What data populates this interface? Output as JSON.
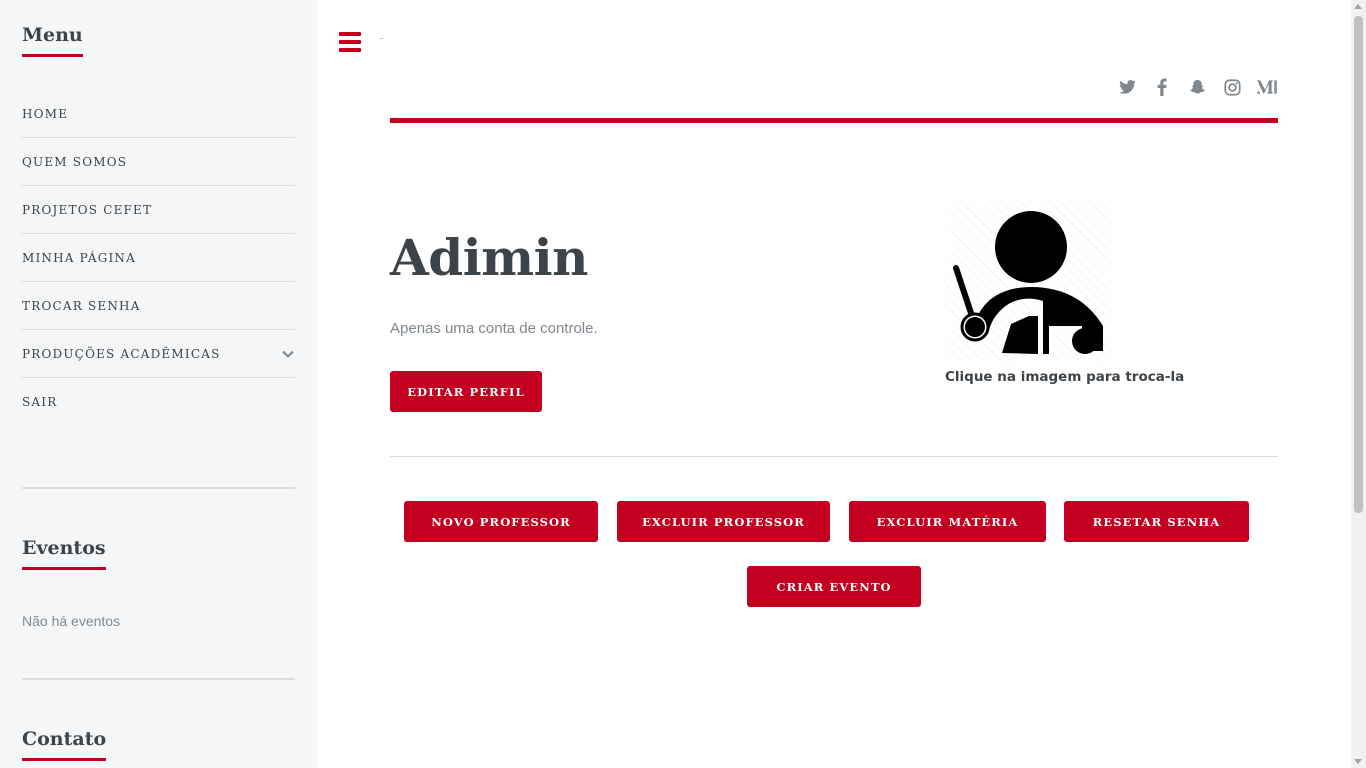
{
  "sidebar": {
    "menu_title": "Menu",
    "menu_items": [
      {
        "label": "HOME"
      },
      {
        "label": "QUEM SOMOS"
      },
      {
        "label": "PROJETOS CEFET"
      },
      {
        "label": "MINHA PÁGINA"
      },
      {
        "label": "TROCAR SENHA"
      },
      {
        "label": "PRODUÇÕES ACADÊMICAS",
        "icon": "chevron-down-icon"
      },
      {
        "label": "SAIR"
      }
    ],
    "events_title": "Eventos",
    "events_empty": "Não há eventos",
    "contact_title": "Contato"
  },
  "header": {
    "menu_toggle_icon": "hamburger-icon",
    "social_icons": [
      "twitter-icon",
      "facebook-icon",
      "snapchat-icon",
      "instagram-icon",
      "medium-icon"
    ]
  },
  "profile": {
    "name": "Adimin",
    "description": "Apenas uma conta de controle.",
    "edit_button": "EDITAR PERFIL",
    "avatar_caption": "Clique na imagem para troca-la"
  },
  "actions": {
    "new_teacher": "NOVO PROFESSOR",
    "delete_teacher": "EXCLUIR PROFESSOR",
    "delete_subject": "EXCLUIR MATÉRIA",
    "reset_password": "RESETAR SENHA",
    "create_event": "CRIAR EVENTO"
  },
  "colors": {
    "accent": "#c3001f",
    "text": "#3d4449",
    "muted": "#7f888f",
    "sidebar_bg": "#f5f6f7"
  }
}
